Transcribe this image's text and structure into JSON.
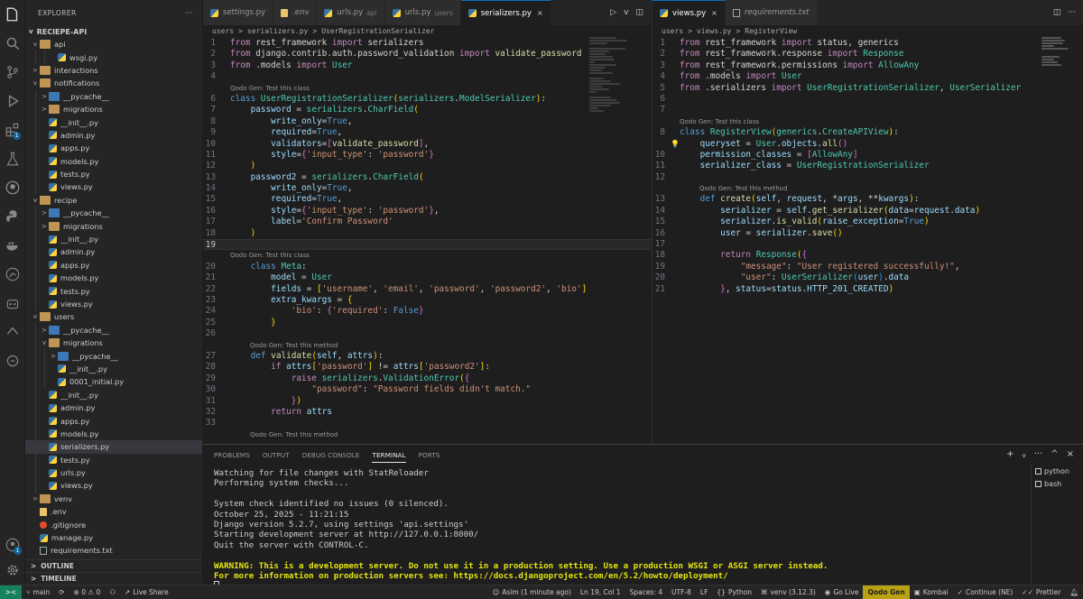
{
  "explorer": {
    "title": "EXPLORER",
    "project": "RECIEPE-API",
    "tree": [
      {
        "label": "api",
        "indent": 1,
        "kind": "folder",
        "chev": "v"
      },
      {
        "label": "wsgi.py",
        "indent": 3,
        "kind": "py",
        "chev": ""
      },
      {
        "label": "interactions",
        "indent": 1,
        "kind": "folder",
        "chev": ">"
      },
      {
        "label": "notifications",
        "indent": 1,
        "kind": "folder",
        "chev": "v"
      },
      {
        "label": "__pycache__",
        "indent": 2,
        "kind": "folderb",
        "chev": ">"
      },
      {
        "label": "migrations",
        "indent": 2,
        "kind": "folder",
        "chev": ">"
      },
      {
        "label": "__init__.py",
        "indent": 2,
        "kind": "py",
        "chev": ""
      },
      {
        "label": "admin.py",
        "indent": 2,
        "kind": "py",
        "chev": ""
      },
      {
        "label": "apps.py",
        "indent": 2,
        "kind": "py",
        "chev": ""
      },
      {
        "label": "models.py",
        "indent": 2,
        "kind": "py",
        "chev": ""
      },
      {
        "label": "tests.py",
        "indent": 2,
        "kind": "py",
        "chev": ""
      },
      {
        "label": "views.py",
        "indent": 2,
        "kind": "py",
        "chev": ""
      },
      {
        "label": "recipe",
        "indent": 1,
        "kind": "folder",
        "chev": "v"
      },
      {
        "label": "__pycache__",
        "indent": 2,
        "kind": "folderb",
        "chev": ">"
      },
      {
        "label": "migrations",
        "indent": 2,
        "kind": "folder",
        "chev": ">"
      },
      {
        "label": "__init__.py",
        "indent": 2,
        "kind": "py",
        "chev": ""
      },
      {
        "label": "admin.py",
        "indent": 2,
        "kind": "py",
        "chev": ""
      },
      {
        "label": "apps.py",
        "indent": 2,
        "kind": "py",
        "chev": ""
      },
      {
        "label": "models.py",
        "indent": 2,
        "kind": "py",
        "chev": ""
      },
      {
        "label": "tests.py",
        "indent": 2,
        "kind": "py",
        "chev": ""
      },
      {
        "label": "views.py",
        "indent": 2,
        "kind": "py",
        "chev": ""
      },
      {
        "label": "users",
        "indent": 1,
        "kind": "folder",
        "chev": "v"
      },
      {
        "label": "__pycache__",
        "indent": 2,
        "kind": "folderb",
        "chev": ">"
      },
      {
        "label": "migrations",
        "indent": 2,
        "kind": "folder",
        "chev": "v"
      },
      {
        "label": "__pycache__",
        "indent": 3,
        "kind": "folderb",
        "chev": ">"
      },
      {
        "label": "__init__.py",
        "indent": 3,
        "kind": "py",
        "chev": ""
      },
      {
        "label": "0001_initial.py",
        "indent": 3,
        "kind": "py",
        "chev": ""
      },
      {
        "label": "__init__.py",
        "indent": 2,
        "kind": "py",
        "chev": ""
      },
      {
        "label": "admin.py",
        "indent": 2,
        "kind": "py",
        "chev": ""
      },
      {
        "label": "apps.py",
        "indent": 2,
        "kind": "py",
        "chev": ""
      },
      {
        "label": "models.py",
        "indent": 2,
        "kind": "py",
        "chev": ""
      },
      {
        "label": "serializers.py",
        "indent": 2,
        "kind": "py",
        "chev": "",
        "selected": true
      },
      {
        "label": "tests.py",
        "indent": 2,
        "kind": "py",
        "chev": ""
      },
      {
        "label": "urls.py",
        "indent": 2,
        "kind": "py",
        "chev": ""
      },
      {
        "label": "views.py",
        "indent": 2,
        "kind": "py",
        "chev": ""
      },
      {
        "label": "venv",
        "indent": 1,
        "kind": "folder",
        "chev": ">"
      },
      {
        "label": ".env",
        "indent": 1,
        "kind": "env",
        "chev": ""
      },
      {
        "label": ".gitignore",
        "indent": 1,
        "kind": "git",
        "chev": ""
      },
      {
        "label": "manage.py",
        "indent": 1,
        "kind": "py",
        "chev": ""
      },
      {
        "label": "requirements.txt",
        "indent": 1,
        "kind": "txt",
        "chev": ""
      }
    ],
    "outline": "OUTLINE",
    "timeline": "TIMELINE"
  },
  "editor1": {
    "tabs": [
      {
        "label": "settings.py",
        "sub": "",
        "active": false,
        "icon": "py"
      },
      {
        "label": ".env",
        "sub": "",
        "active": false,
        "icon": "env"
      },
      {
        "label": "urls.py",
        "sub": "api",
        "active": false,
        "icon": "py"
      },
      {
        "label": "urls.py",
        "sub": "users",
        "active": false,
        "icon": "py"
      },
      {
        "label": "serializers.py",
        "sub": "",
        "active": true,
        "icon": "py"
      }
    ],
    "breadcrumb": [
      "users",
      ">",
      "serializers.py",
      ">",
      "UserRegistrationSerializer"
    ],
    "lines": [
      {
        "n": "1",
        "h": "<span class='kw'>from</span> rest_framework <span class='kw'>import</span> serializers"
      },
      {
        "n": "2",
        "h": "<span class='kw'>from</span> django.contrib.auth.password_validation <span class='kw'>import</span> <span class='fn'>validate_password</span>"
      },
      {
        "n": "3",
        "h": "<span class='kw'>from</span> .models <span class='kw'>import</span> <span class='cl'>User</span>"
      },
      {
        "n": "4",
        "h": ""
      },
      {
        "n": "",
        "lens": "Qodo Gen: Test this class"
      },
      {
        "n": "6",
        "h": "<span class='kb'>class</span> <span class='cl'>UserRegistrationSerializer</span><span class='br'>(</span><span class='cl'>serializers</span>.<span class='cl'>ModelSerializer</span><span class='br'>)</span>:"
      },
      {
        "n": "7",
        "h": "    <span class='vr'>password</span> = <span class='cl'>serializers</span>.<span class='cl'>CharField</span><span class='br'>(</span>"
      },
      {
        "n": "8",
        "h": "        <span class='vr'>write_only</span>=<span class='kb'>True</span>,"
      },
      {
        "n": "9",
        "h": "        <span class='vr'>required</span>=<span class='kb'>True</span>,"
      },
      {
        "n": "10",
        "h": "        <span class='vr'>validators</span>=<span class='br2'>[</span><span class='fn'>validate_password</span><span class='br2'>]</span>,"
      },
      {
        "n": "11",
        "h": "        <span class='vr'>style</span>=<span class='br2'>{</span><span class='st'>'input_type'</span>: <span class='st'>'password'</span><span class='br2'>}</span>"
      },
      {
        "n": "12",
        "h": "    <span class='br'>)</span>"
      },
      {
        "n": "13",
        "h": "    <span class='vr'>password2</span> = <span class='cl'>serializers</span>.<span class='cl'>CharField</span><span class='br'>(</span>"
      },
      {
        "n": "14",
        "h": "        <span class='vr'>write_only</span>=<span class='kb'>True</span>,"
      },
      {
        "n": "15",
        "h": "        <span class='vr'>required</span>=<span class='kb'>True</span>,"
      },
      {
        "n": "16",
        "h": "        <span class='vr'>style</span>=<span class='br2'>{</span><span class='st'>'input_type'</span>: <span class='st'>'password'</span><span class='br2'>}</span>,"
      },
      {
        "n": "17",
        "h": "        <span class='vr'>label</span>=<span class='st'>'Confirm Password'</span>"
      },
      {
        "n": "18",
        "h": "    <span class='br'>)</span>"
      },
      {
        "n": "19",
        "h": "",
        "cur": true
      },
      {
        "n": "",
        "lens": "Qodo Gen: Test this class"
      },
      {
        "n": "20",
        "h": "    <span class='kb'>class</span> <span class='cl'>Meta</span>:"
      },
      {
        "n": "21",
        "h": "        <span class='vr'>model</span> = <span class='cl'>User</span>"
      },
      {
        "n": "22",
        "h": "        <span class='vr'>fields</span> = <span class='br'>[</span><span class='st'>'username'</span>, <span class='st'>'email'</span>, <span class='st'>'password'</span>, <span class='st'>'password2'</span>, <span class='st'>'bio'</span><span class='br'>]</span>"
      },
      {
        "n": "23",
        "h": "        <span class='vr'>extra_kwargs</span> = <span class='br'>{</span>"
      },
      {
        "n": "24",
        "h": "            <span class='st'>'bio'</span>: <span class='br2'>{</span><span class='st'>'required'</span>: <span class='kb'>False</span><span class='br2'>}</span>"
      },
      {
        "n": "25",
        "h": "        <span class='br'>}</span>"
      },
      {
        "n": "26",
        "h": ""
      },
      {
        "n": "",
        "lens": "Qodo Gen: Test this method"
      },
      {
        "n": "27",
        "h": "    <span class='kb'>def</span> <span class='fn'>validate</span><span class='br'>(</span><span class='vr'>self</span>, <span class='vr'>attrs</span><span class='br'>)</span>:"
      },
      {
        "n": "28",
        "h": "        <span class='kw'>if</span> <span class='vr'>attrs</span><span class='br'>[</span><span class='st'>'password'</span><span class='br'>]</span> != <span class='vr'>attrs</span><span class='br'>[</span><span class='st'>'password2'</span><span class='br'>]</span>:"
      },
      {
        "n": "29",
        "h": "            <span class='kw'>raise</span> <span class='cl'>serializers</span>.<span class='cl'>ValidationError</span><span class='br'>(</span><span class='br2'>{</span>"
      },
      {
        "n": "30",
        "h": "                <span class='st'>\"password\"</span>: <span class='st'>\"Password fields didn't match.\"</span>"
      },
      {
        "n": "31",
        "h": "            <span class='br2'>}</span><span class='br'>)</span>"
      },
      {
        "n": "32",
        "h": "        <span class='kw'>return</span> <span class='vr'>attrs</span>"
      },
      {
        "n": "33",
        "h": ""
      },
      {
        "n": "",
        "lens": "Qodo Gen: Test this method"
      }
    ]
  },
  "editor2": {
    "tabs": [
      {
        "label": "views.py",
        "sub": "",
        "active": true,
        "icon": "py"
      },
      {
        "label": "requirements.txt",
        "sub": "",
        "active": false,
        "icon": "txt"
      }
    ],
    "breadcrumb": [
      "users",
      ">",
      "views.py",
      ">",
      "RegisterView"
    ],
    "lines": [
      {
        "n": "1",
        "h": "<span class='kw'>from</span> rest_framework <span class='kw'>import</span> status, generics"
      },
      {
        "n": "2",
        "h": "<span class='kw'>from</span> rest_framework.response <span class='kw'>import</span> <span class='cl'>Response</span>"
      },
      {
        "n": "3",
        "h": "<span class='kw'>from</span> rest_framework.permissions <span class='kw'>import</span> <span class='cl'>AllowAny</span>"
      },
      {
        "n": "4",
        "h": "<span class='kw'>from</span> .models <span class='kw'>import</span> <span class='cl'>User</span>"
      },
      {
        "n": "5",
        "h": "<span class='kw'>from</span> .serializers <span class='kw'>import</span> <span class='cl'>UserRegistrationSerializer</span>, <span class='cl'>UserSerializer</span>"
      },
      {
        "n": "6",
        "h": ""
      },
      {
        "n": "7",
        "h": ""
      },
      {
        "n": "",
        "lens": "Qodo Gen: Test this class"
      },
      {
        "n": "8",
        "h": "<span class='kb'>class</span> <span class='cl'>RegisterView</span><span class='br'>(</span><span class='cl'>generics</span>.<span class='cl'>CreateAPIView</span><span class='br'>)</span>:"
      },
      {
        "n": "9",
        "h": "    <span class='vr'>queryset</span> = <span class='cl'>User</span>.<span class='vr'>objects</span>.<span class='fn'>all</span><span class='br2'>()</span>",
        "cur": true,
        "bulb": true
      },
      {
        "n": "10",
        "h": "    <span class='vr'>permission_classes</span> = <span class='br2'>[</span><span class='cl'>AllowAny</span><span class='br2'>]</span>"
      },
      {
        "n": "11",
        "h": "    <span class='vr'>serializer_class</span> = <span class='cl'>UserRegistrationSerializer</span>"
      },
      {
        "n": "12",
        "h": ""
      },
      {
        "n": "",
        "lens": "Qodo Gen: Test this method"
      },
      {
        "n": "13",
        "h": "    <span class='kb'>def</span> <span class='fn'>create</span><span class='br'>(</span><span class='vr'>self</span>, <span class='vr'>request</span>, *<span class='vr'>args</span>, **<span class='vr'>kwargs</span><span class='br'>)</span>:"
      },
      {
        "n": "14",
        "h": "        <span class='vr'>serializer</span> = <span class='vr'>self</span>.<span class='fn'>get_serializer</span><span class='br'>(</span><span class='vr'>data</span>=<span class='vr'>request</span>.<span class='vr'>data</span><span class='br'>)</span>"
      },
      {
        "n": "15",
        "h": "        <span class='vr'>serializer</span>.<span class='fn'>is_valid</span><span class='br'>(</span><span class='vr'>raise_exception</span>=<span class='kb'>True</span><span class='br'>)</span>"
      },
      {
        "n": "16",
        "h": "        <span class='vr'>user</span> = <span class='vr'>serializer</span>.<span class='fn'>save</span><span class='br'>()</span>"
      },
      {
        "n": "17",
        "h": ""
      },
      {
        "n": "18",
        "h": "        <span class='kw'>return</span> <span class='cl'>Response</span><span class='br'>(</span><span class='br2'>{</span>"
      },
      {
        "n": "19",
        "h": "            <span class='st'>\"message\"</span>: <span class='st'>\"User registered successfully!\"</span>,"
      },
      {
        "n": "20",
        "h": "            <span class='st'>\"user\"</span>: <span class='cl'>UserSerializer</span><span class='br3'>(</span><span class='vr'>user</span><span class='br3'>)</span>.<span class='vr'>data</span>"
      },
      {
        "n": "21",
        "h": "        <span class='br2'>}</span>, <span class='vr'>status</span>=<span class='vr'>status</span>.<span class='vr'>HTTP_201_CREATED</span><span class='br'>)</span>"
      }
    ]
  },
  "panel": {
    "tabs": [
      "PROBLEMS",
      "OUTPUT",
      "DEBUG CONSOLE",
      "TERMINAL",
      "PORTS"
    ],
    "active_tab": "TERMINAL",
    "terminal_lines": [
      "Watching for file changes with StatReloader",
      "Performing system checks...",
      "",
      "System check identified no issues (0 silenced).",
      "October 25, 2025 - 11:21:15",
      "Django version 5.2.7, using settings 'api.settings'",
      "Starting development server at http://127.0.0.1:8000/",
      "Quit the server with CONTROL-C.",
      ""
    ],
    "warning_lines": [
      "WARNING: This is a development server. Do not use it in a production setting. Use a production WSGI or ASGI server instead.",
      "For more information on production servers see: https://docs.djangoproject.com/en/5.2/howto/deployment/"
    ],
    "terminals": [
      "python",
      "bash"
    ]
  },
  "statusbar": {
    "branch": "main",
    "errors": "0",
    "warnings": "0",
    "live_share": "Live Share",
    "blame": "Asim (1 minute ago)",
    "position": "Ln 19, Col 1",
    "spaces": "Spaces: 4",
    "encoding": "UTF-8",
    "eol": "LF",
    "language": "Python",
    "venv": "venv (3.12.3)",
    "go_live": "Go Live",
    "qodo": "Qodo Gen",
    "kombai": "Kombai",
    "continue": "Continue (NE)",
    "prettier": "Prettier"
  },
  "colors": {
    "accent": "#0e70c0",
    "qodo": "#b8a214",
    "remote": "#16825d",
    "warning": "#e5e510"
  }
}
